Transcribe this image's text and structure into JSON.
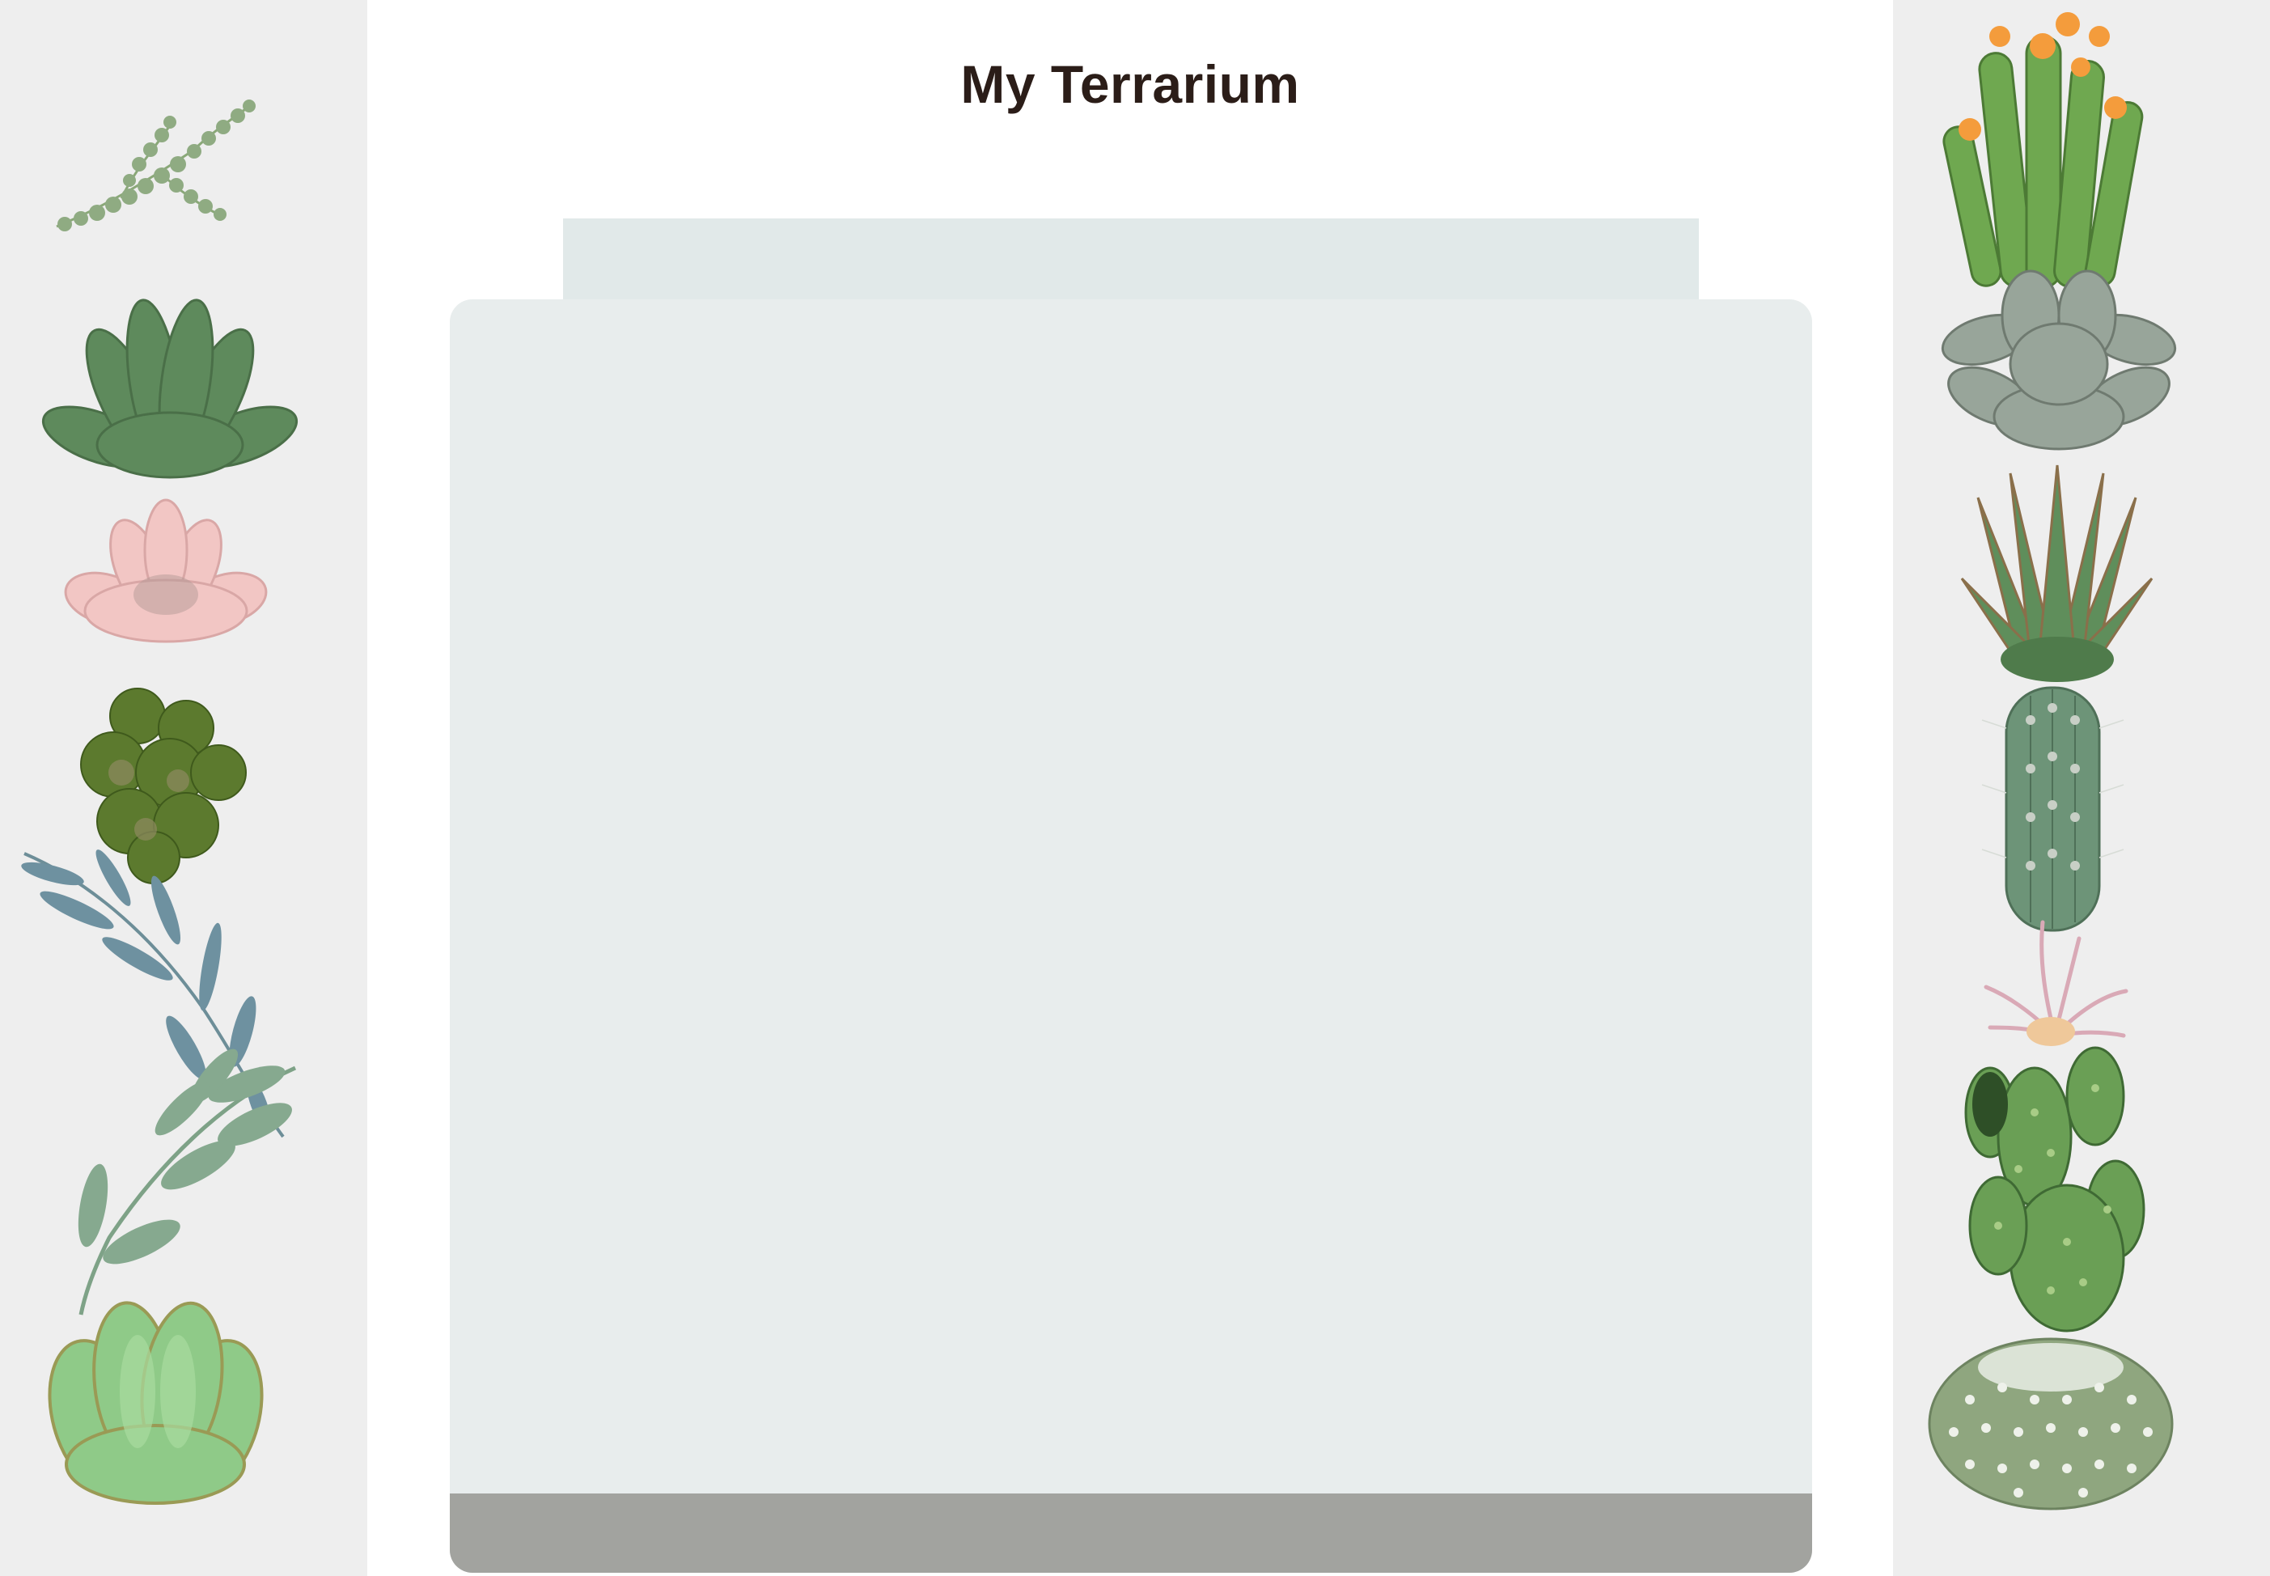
{
  "page": {
    "title": "My Terrarium"
  },
  "colors": {
    "background": "#ffffff",
    "side_panel": "#eeeeee",
    "title_text": "#2b1d18",
    "jar_top": "#e1e9e9",
    "jar_body": "#e8eded",
    "jar_bottom": "#a2a39f"
  },
  "left_plants": [
    "string-of-pearls-plant",
    "green-rosette-succulent",
    "pink-echeveria",
    "clustered-leafy-succulent",
    "blue-eucalyptus-branch",
    "trailing-green-branch",
    "round-jade-succulent"
  ],
  "right_plants": [
    "flowering-finger-cactus",
    "grey-rosette-succulent",
    "spiky-aloe",
    "columnar-cactus",
    "pink-air-plant",
    "bunny-ear-cactus",
    "fuzzy-round-cactus"
  ]
}
